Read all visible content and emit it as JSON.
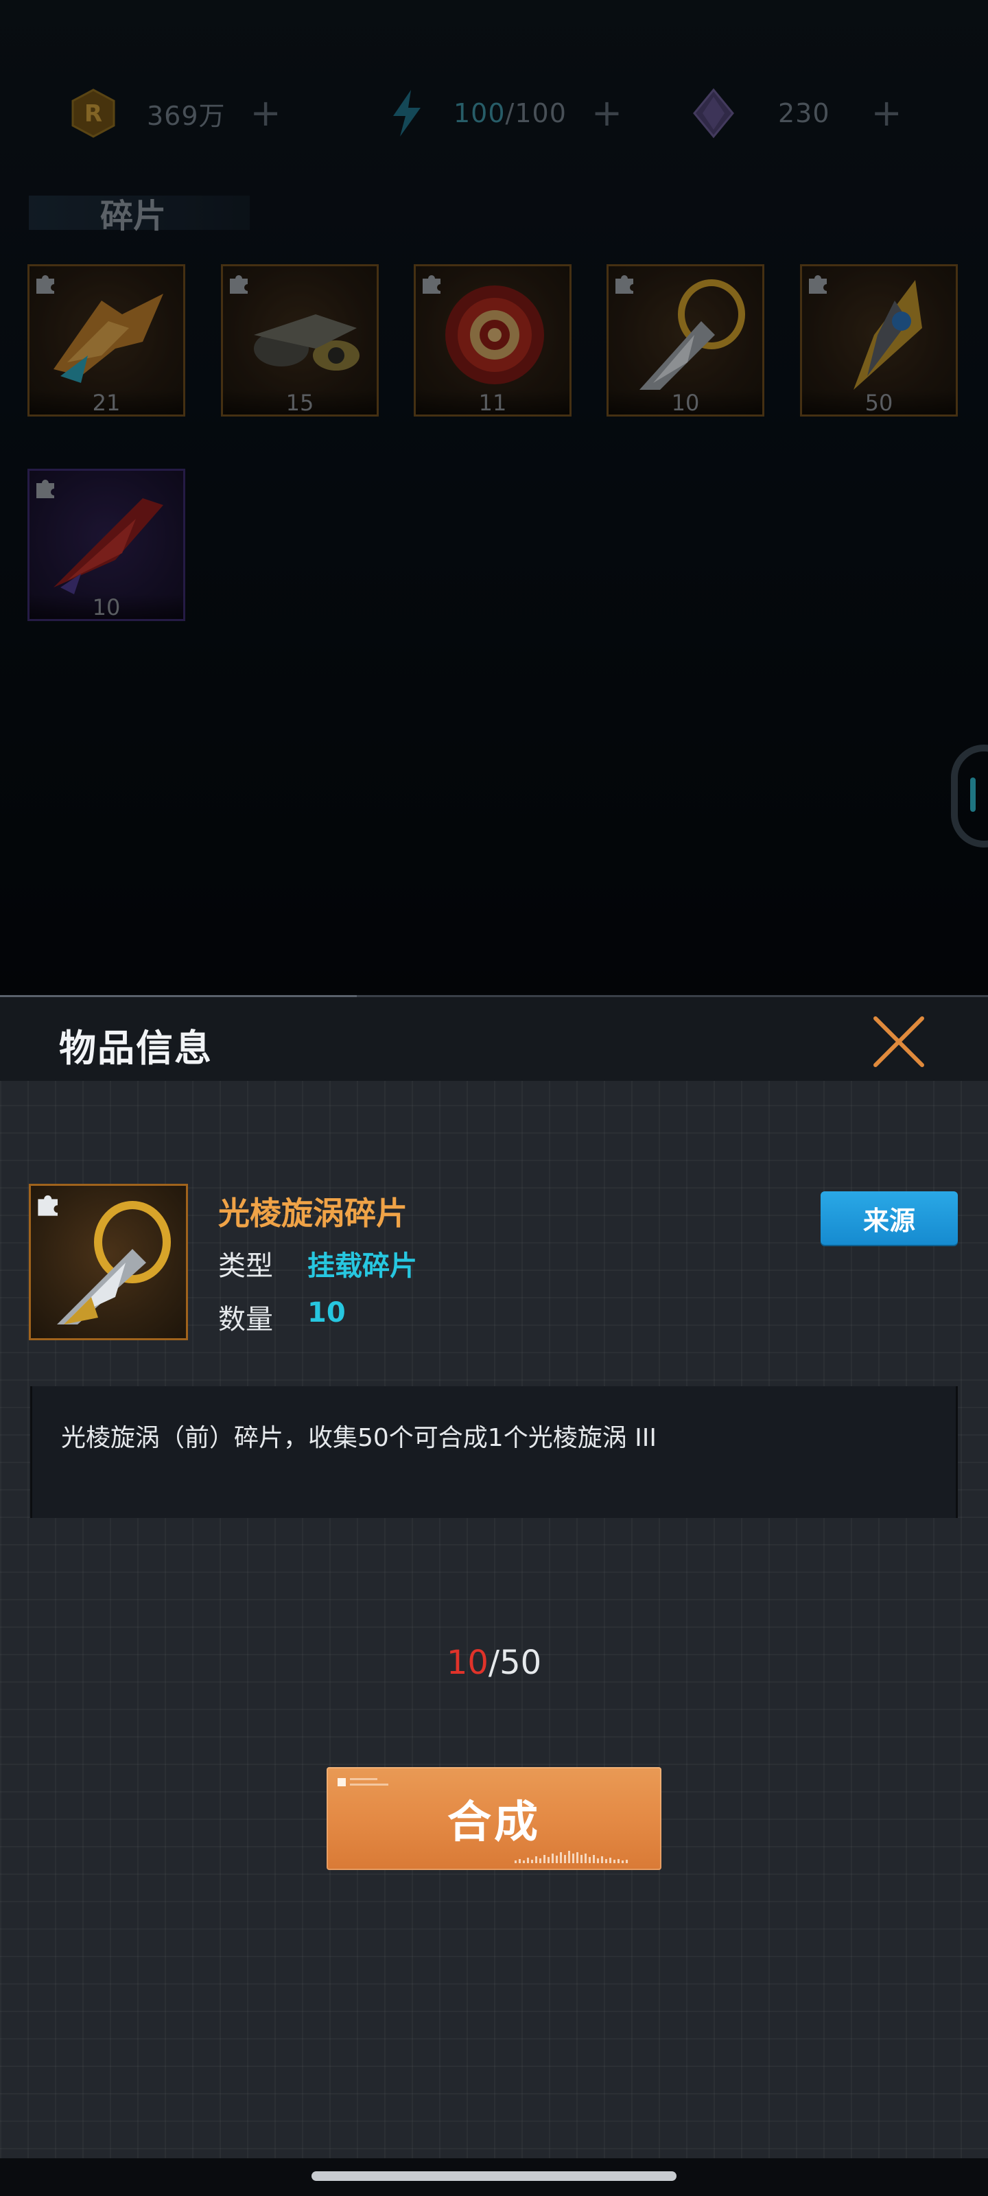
{
  "currencies": [
    {
      "name": "coin",
      "icon": "r-coin-icon",
      "value": "369万"
    },
    {
      "name": "energy",
      "icon": "lightning-icon",
      "value_current": "100",
      "value_sep": "/100"
    },
    {
      "name": "crystal",
      "icon": "crystal-icon",
      "value": "230"
    }
  ],
  "plus_label": "+",
  "tab_title": "碎片",
  "fragments": [
    {
      "count": "21",
      "rarity": "orange",
      "icon": "fighter-jet-fragment-icon"
    },
    {
      "count": "15",
      "rarity": "orange",
      "icon": "drone-fragment-icon"
    },
    {
      "count": "11",
      "rarity": "orange",
      "icon": "shield-disc-fragment-icon"
    },
    {
      "count": "10",
      "rarity": "orange",
      "icon": "ring-vortex-fragment-icon"
    },
    {
      "count": "50",
      "rarity": "orange",
      "icon": "blade-fragment-icon"
    },
    {
      "count": "10",
      "rarity": "purple",
      "icon": "red-jet-fragment-icon"
    }
  ],
  "panel": {
    "title": "物品信息",
    "item_name": "光棱旋涡碎片",
    "type_label": "类型",
    "type_value": "挂载碎片",
    "qty_label": "数量",
    "qty_value": "10",
    "source_button": "来源",
    "description": "光棱旋涡（前）碎片，收集50个可合成1个光棱旋涡 III",
    "progress_current": "10",
    "progress_total": "/50",
    "synth_button": "合成"
  },
  "colors": {
    "accent_orange": "#f0a347",
    "accent_cyan": "#27c7e0",
    "progress_red": "#e0332a",
    "source_blue": "#1ea0e0",
    "synth_orange": "#e48a45"
  }
}
